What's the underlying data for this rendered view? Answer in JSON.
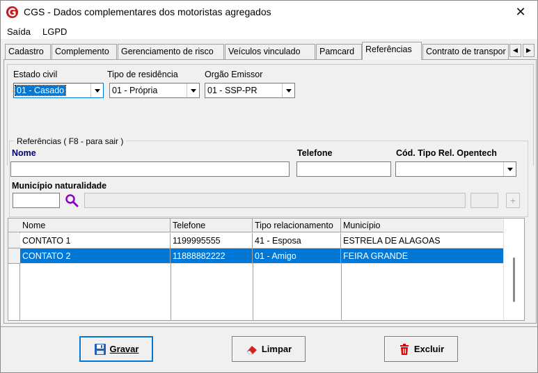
{
  "window": {
    "title": "CGS - Dados complementares dos motoristas agregados",
    "close_glyph": "✕",
    "icon": "cgs-logo-icon"
  },
  "menu": {
    "items": [
      {
        "label": "Saída"
      },
      {
        "label": "LGPD"
      }
    ]
  },
  "tabs": [
    {
      "label": "Cadastro"
    },
    {
      "label": "Complemento"
    },
    {
      "label": "Gerenciamento de risco"
    },
    {
      "label": "Veículos vinculado"
    },
    {
      "label": "Pamcard"
    },
    {
      "label": "Referências",
      "active": true
    },
    {
      "label": "Contrato de transpor"
    }
  ],
  "tab_scroll": {
    "left": "◀",
    "right": "▶"
  },
  "form": {
    "estado_civil": {
      "label": "Estado civil",
      "value": "01 - Casado"
    },
    "tipo_residencia": {
      "label": "Tipo de residência",
      "value": "01 - Própria"
    },
    "orgao_emissor": {
      "label": "Orgão Emissor",
      "value": "01 - SSP-PR"
    }
  },
  "referencias": {
    "caption": "Referências ( F8 - para sair )",
    "nome_label": "Nome",
    "telefone_label": "Telefone",
    "cod_tipo_label": "Cód. Tipo Rel. Opentech",
    "municipio_label": "Município naturalidade",
    "add_glyph": "+"
  },
  "grid": {
    "columns": [
      "Nome",
      "Telefone",
      "Tipo relacionamento",
      "Município"
    ],
    "rows": [
      {
        "nome": "CONTATO 1",
        "telefone": "1199995555",
        "tipo": "41 - Esposa",
        "municipio": "ESTRELA DE ALAGOAS"
      },
      {
        "nome": "CONTATO 2",
        "telefone": "11888882222",
        "tipo": "01 - Amigo",
        "municipio": "FEIRA GRANDE",
        "selected": true
      }
    ]
  },
  "buttons": {
    "gravar": "Gravar",
    "limpar": "Limpar",
    "excluir": "Excluir"
  },
  "colors": {
    "selection": "#0078d7",
    "nome_label": "#00006e",
    "sort_indicator": "#e00000",
    "delete_icon": "#e00000",
    "search_icon": "#8a00c8"
  }
}
